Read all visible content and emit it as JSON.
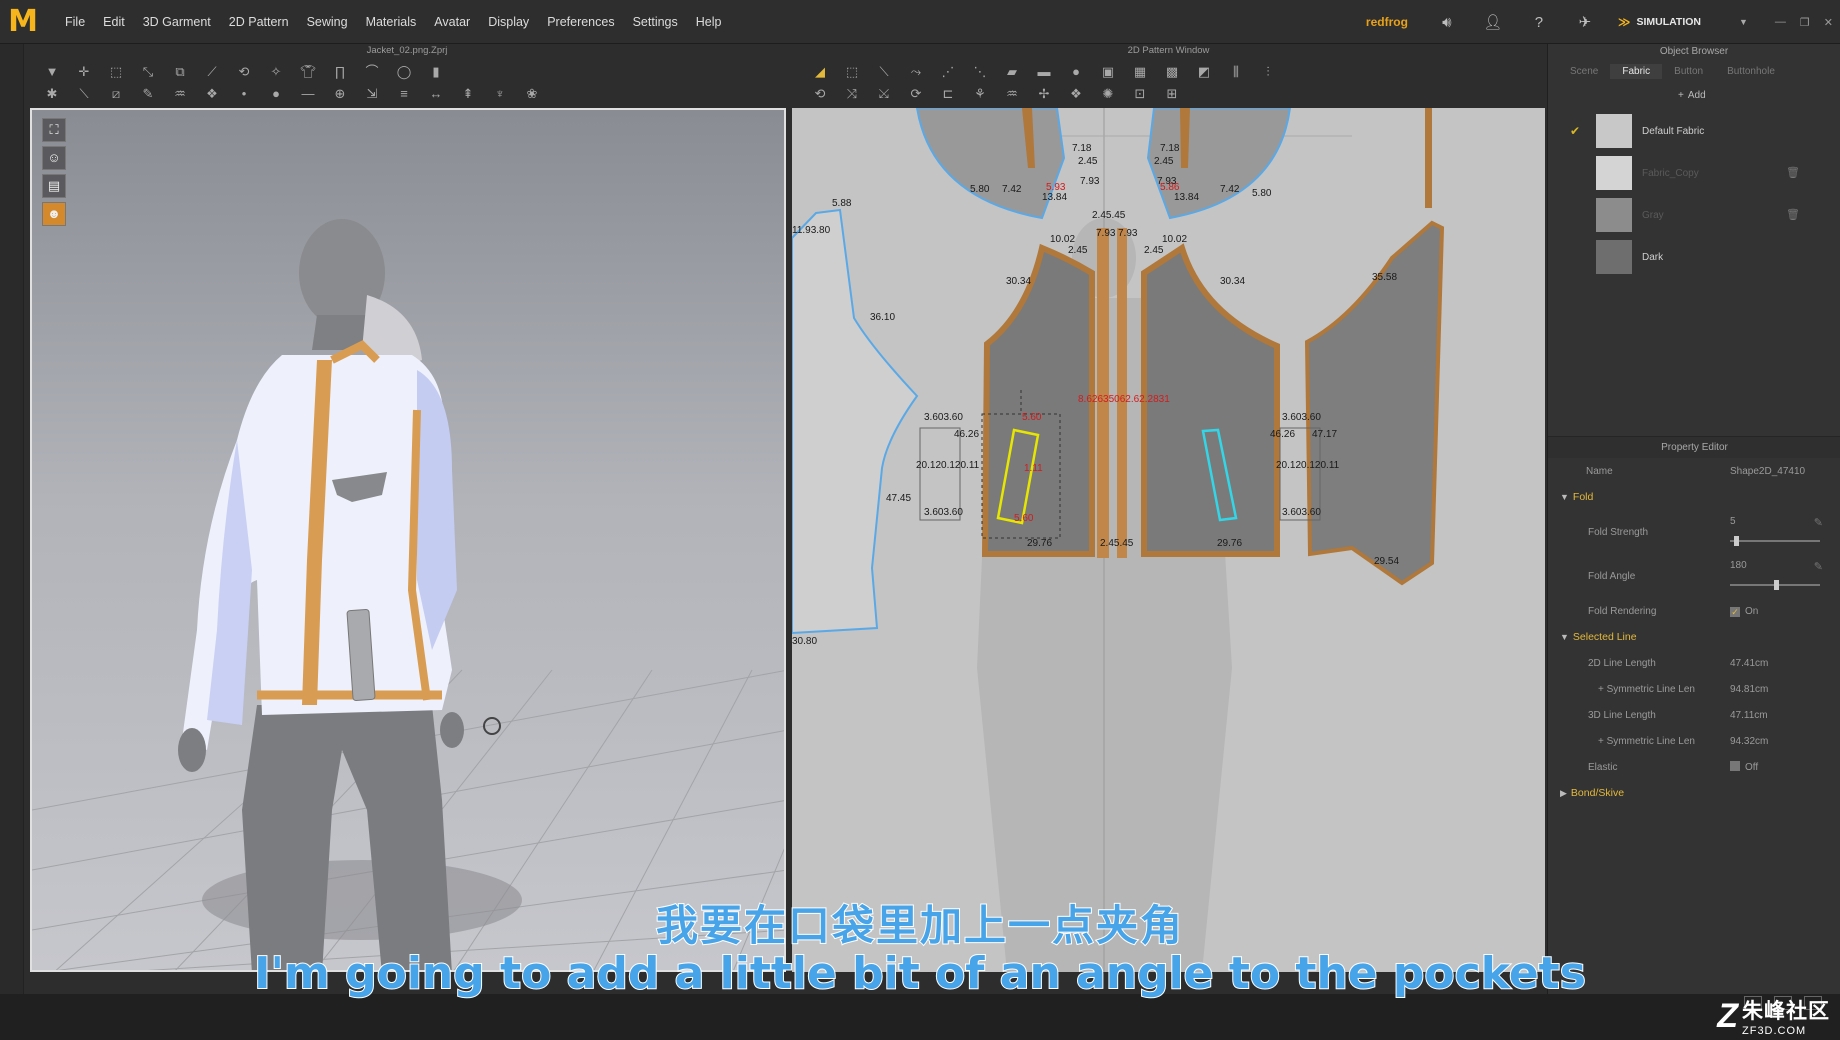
{
  "app": {
    "logo": "M"
  },
  "menu": [
    "File",
    "Edit",
    "3D Garment",
    "2D Pattern",
    "Sewing",
    "Materials",
    "Avatar",
    "Display",
    "Preferences",
    "Settings",
    "Help"
  ],
  "user": {
    "name": "redfrog"
  },
  "mode": {
    "label": "SIMULATION"
  },
  "panel_3d": {
    "title": "Jacket_02.png.Zprj"
  },
  "panel_2d": {
    "title": "2D Pattern Window",
    "measurements": {
      "a": "5.88",
      "b": "11.93.80",
      "c": "36.10",
      "d": "47.45",
      "e": "30.80",
      "f": "5.80",
      "g": "7.42",
      "h": "13.84",
      "i": "7.18",
      "j": "2.45",
      "k": "5.93",
      "l": "7.93",
      "m": "2.45.45",
      "n": "7.93",
      "o": "7.93",
      "p": "10.02",
      "q": "2.45",
      "r": "30.34",
      "s": "3.603.60",
      "t": "46.26",
      "u": "20.120.120.11",
      "v": "3.603.60",
      "w": "29.76",
      "x": "2.45.45",
      "y": "35.58",
      "z": "29.54",
      "aa": "47.17",
      "ab": "20.120.120.11",
      "ac": "5.86",
      "ad": "7.18",
      "ae": "2.45",
      "af": "7.42",
      "ag": "5.80",
      "ah": "13.84",
      "ai": "10.02",
      "aj": "2.45",
      "ak": "30.34",
      "al": "29.76",
      "am": "3.603.60",
      "an": "46.26",
      "ao": "3.603.60",
      "ap": "7.93",
      "red_center": "8.62635062.62.2831",
      "red_pocket_top": "5.60",
      "red_pocket_mid": "1.11",
      "red_pocket_bottom": "5.60",
      "red_l1": "20.12",
      "red_l2": "20.11"
    }
  },
  "object_browser": {
    "title": "Object Browser",
    "tabs": [
      "Scene",
      "Fabric",
      "Button",
      "Buttonhole"
    ],
    "active_tab": "Fabric",
    "add_label": "Add",
    "fabrics": [
      {
        "name": "Default Fabric",
        "checked": true,
        "swatch": "#c8c8c8",
        "dim": false
      },
      {
        "name": "Fabric_Copy",
        "checked": false,
        "swatch": "#d4d4d4",
        "dim": true
      },
      {
        "name": "Gray",
        "checked": false,
        "swatch": "#8c8c8c",
        "dim": true
      },
      {
        "name": "Dark",
        "checked": false,
        "swatch": "#6e6e6e",
        "dim": false
      }
    ]
  },
  "property_editor": {
    "title": "Property Editor",
    "name_key": "Name",
    "name_val": "Shape2D_47410",
    "fold_section": "Fold",
    "fold_strength_key": "Fold Strength",
    "fold_strength_val": "5",
    "fold_strength_level": 0.05,
    "fold_angle_key": "Fold Angle",
    "fold_angle_val": "180",
    "fold_angle_level": 0.5,
    "fold_rendering_key": "Fold Rendering",
    "fold_rendering_val": "On",
    "selected_line_section": "Selected Line",
    "len2d_key": "2D Line Length",
    "len2d_val": "47.41cm",
    "sym2d_key": "+ Symmetric Line Len",
    "sym2d_val": "94.81cm",
    "len3d_key": "3D Line Length",
    "len3d_val": "47.11cm",
    "sym3d_key": "+ Symmetric Line Len",
    "sym3d_val": "94.32cm",
    "elastic_key": "Elastic",
    "elastic_val": "Off",
    "bond_section": "Bond/Skive"
  },
  "subtitles": {
    "cn": "我要在口袋里加上一点夹角",
    "en": "I'm going to add a little bit of an angle to the pockets"
  },
  "watermark": {
    "cn": "朱峰社区",
    "url": "ZF3D.COM"
  },
  "colors": {
    "accent": "#f6b51d",
    "selection_yellow": "#e6e600",
    "selection_cyan": "#33d6e6",
    "outline_blue": "#5aa9e6",
    "seam_orange": "#b0783a",
    "subtitle_blue": "#48a4e8"
  }
}
